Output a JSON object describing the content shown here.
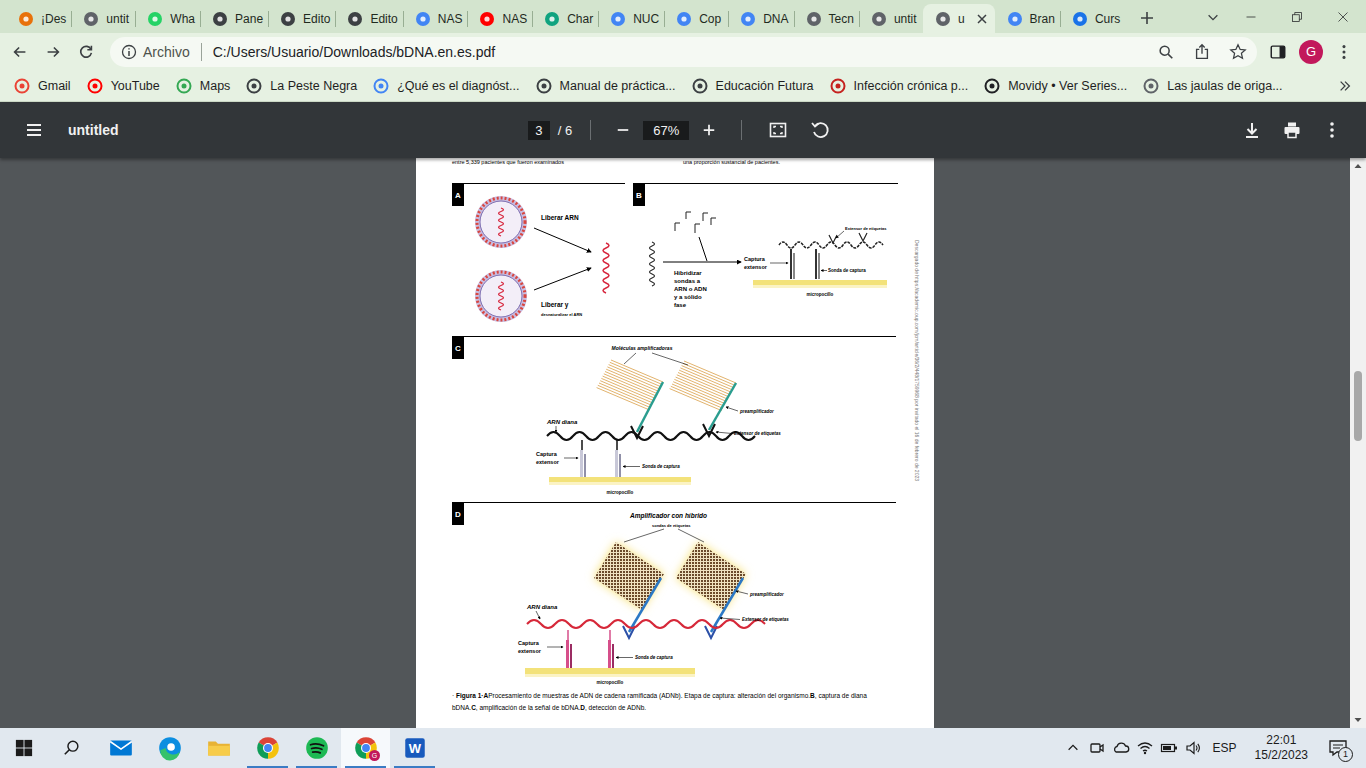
{
  "browser": {
    "tabs": [
      {
        "label": "¡Des",
        "selected": false,
        "color": "#e8710a"
      },
      {
        "label": "untit",
        "selected": false,
        "color": "#5f6368"
      },
      {
        "label": "Wha",
        "selected": false,
        "color": "#25d366"
      },
      {
        "label": "Pane",
        "selected": false,
        "color": "#3c4043"
      },
      {
        "label": "Edito",
        "selected": false,
        "color": "#3c4043"
      },
      {
        "label": "Edito",
        "selected": false,
        "color": "#3c4043"
      },
      {
        "label": "NAS",
        "selected": false,
        "color": "#4285f4"
      },
      {
        "label": "NAS",
        "selected": false,
        "color": "#ff0000"
      },
      {
        "label": "Char",
        "selected": false,
        "color": "#10a37f"
      },
      {
        "label": "NUC",
        "selected": false,
        "color": "#4285f4"
      },
      {
        "label": "Cop",
        "selected": false,
        "color": "#4285f4"
      },
      {
        "label": "DNA",
        "selected": false,
        "color": "#4285f4"
      },
      {
        "label": "Tecn",
        "selected": false,
        "color": "#5f6368"
      },
      {
        "label": "untit",
        "selected": false,
        "color": "#5f6368"
      },
      {
        "label": "u",
        "selected": true,
        "color": "#5f6368"
      },
      {
        "label": "Bran",
        "selected": false,
        "color": "#4285f4"
      },
      {
        "label": "Curs",
        "selected": false,
        "color": "#1a73e8"
      }
    ],
    "address": {
      "scheme_label": "Archivo",
      "url": "C:/Users/Usuario/Downloads/bDNA.en.es.pdf"
    },
    "profile_initial": "G",
    "bookmarks": [
      {
        "label": "Gmail",
        "color": "#ea4335"
      },
      {
        "label": "YouTube",
        "color": "#ff0000"
      },
      {
        "label": "Maps",
        "color": "#34a853"
      },
      {
        "label": "La Peste Negra",
        "color": "#3c4043"
      },
      {
        "label": "¿Qué es el diagnóst...",
        "color": "#4285f4"
      },
      {
        "label": "Manual de práctica...",
        "color": "#3c4043"
      },
      {
        "label": "Educación Futura",
        "color": "#3c4043"
      },
      {
        "label": "Infección crónica p...",
        "color": "#c5221f"
      },
      {
        "label": "Movidy • Ver Series...",
        "color": "#202124"
      },
      {
        "label": "Las jaulas de origa...",
        "color": "#5f6368"
      }
    ]
  },
  "pdf_viewer": {
    "title": "untitled",
    "page": "3",
    "page_total": "/ 6",
    "zoom": "67%",
    "scroll_level": 0.42
  },
  "document": {
    "top_left": "entre 5,339 pacientes que fueron examinados",
    "top_right": "una proporción sustancial de pacientes.",
    "watermark": "Descargado de https://academic.oup.com/jcm/article/36/2/448/1759968 por invitado el 16 de febrero de 2023",
    "panel_a": {
      "letter": "A",
      "release": "Liberar ARN",
      "release_denature": "Liberar y",
      "denature": "desnaturalizar el ARN"
    },
    "panel_b": {
      "letter": "B",
      "hybridize": [
        "Hibridizar",
        "sondas a",
        "ARN o ADN",
        "y a sólido",
        "fase"
      ],
      "capture_extender": [
        "Captura",
        "extensor"
      ],
      "label_extender": "Extensor de etiquetas",
      "capture_probe": "Sonda de captura",
      "microwell": "micropocillo"
    },
    "panel_c": {
      "letter": "C",
      "amplifiers": "Moléculas amplificadoras",
      "preamplifier": "preamplificador",
      "label_extender": "Extensor de etiquetas",
      "target": "ARN diana",
      "capture_extender": [
        "Captura",
        "extensor"
      ],
      "capture_probe": "Sonda de captura",
      "microwell": "micropocillo"
    },
    "panel_d": {
      "letter": "D",
      "amplifier": "Amplificador con híbrido",
      "label_probes": "sondas de etiquetas",
      "preamplifier": "preamplificador",
      "label_extender": "Extensor de etiquetas",
      "target": "ARN diana",
      "capture_extender": [
        "Captura",
        "extensor"
      ],
      "capture_probe": "Sonda de captura",
      "microwell": "micropocillo"
    },
    "caption": [
      {
        "text": "· ",
        "bold": false
      },
      {
        "text": "Figura 1·A",
        "bold": true
      },
      {
        "text": "Procesamiento de muestras de ADN de cadena ramificada (ADNb). Etapa de captura: alteración del organismo.",
        "bold": false
      },
      {
        "text": "B",
        "bold": true
      },
      {
        "text": ", captura de diana bDNA.",
        "bold": false
      },
      {
        "text": "C",
        "bold": true
      },
      {
        "text": ", amplificación de la señal de bDNA.",
        "bold": false
      },
      {
        "text": "D",
        "bold": true
      },
      {
        "text": ", detección de ADNb.",
        "bold": false
      }
    ]
  },
  "taskbar": {
    "apps": [
      {
        "kind": "mail",
        "running": false,
        "active": false
      },
      {
        "kind": "edge",
        "running": false,
        "active": false
      },
      {
        "kind": "explorer",
        "running": false,
        "active": false
      },
      {
        "kind": "chrome",
        "running": true,
        "active": false
      },
      {
        "kind": "spotify",
        "running": true,
        "active": false
      },
      {
        "kind": "chrome",
        "running": true,
        "active": true,
        "badge": "G"
      },
      {
        "kind": "word",
        "running": true,
        "active": false,
        "glyph": "W"
      }
    ],
    "language": "ESP",
    "time": "22:01",
    "date": "15/2/2023",
    "notifications": "1"
  }
}
